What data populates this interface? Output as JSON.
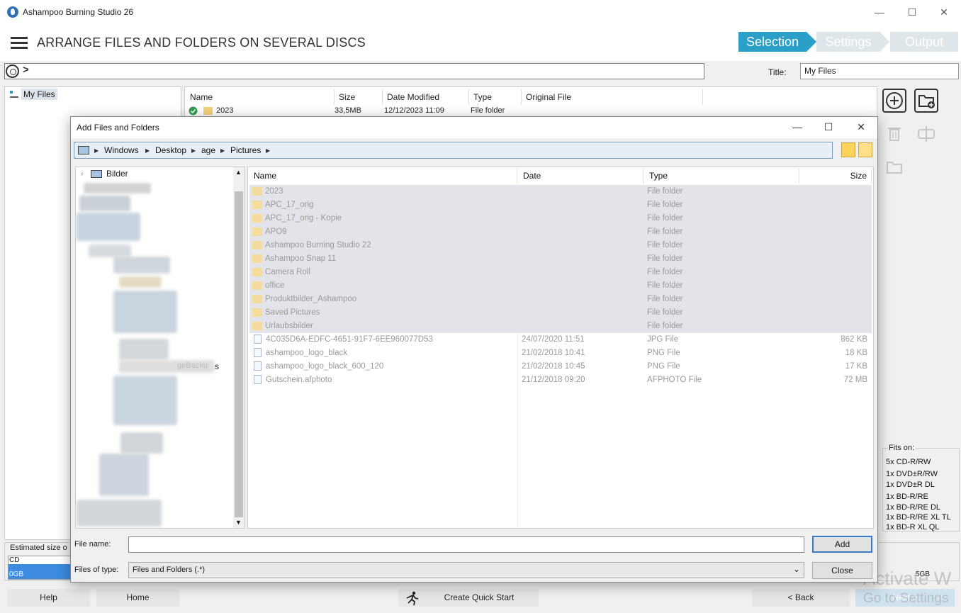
{
  "app": {
    "title": "Ashampoo Burning Studio 26"
  },
  "window_controls": {
    "minimize": "—",
    "maximize": "☐",
    "close": "✕"
  },
  "header": {
    "title": "ARRANGE FILES AND FOLDERS ON SEVERAL DISCS",
    "steps": [
      "Selection",
      "Settings",
      "Output"
    ],
    "active_step": "Selection",
    "accent_color": "#2a9fc8"
  },
  "pathbar": {
    "chevron": ">",
    "title_label": "Title:",
    "title_value": "My Files"
  },
  "tree": {
    "root": "My Files"
  },
  "list": {
    "columns": [
      "Name",
      "Size",
      "Date Modified",
      "Type",
      "Original File"
    ],
    "rows": [
      {
        "name": "2023",
        "size": "33,5MB",
        "date": "12/12/2023 11:09",
        "type": "File folder",
        "original": ""
      }
    ]
  },
  "side_tools": [
    "add-icon",
    "new-folder-icon",
    "trash-icon",
    "split-icon",
    "folder-open-icon"
  ],
  "fits": {
    "title": "Fits on:",
    "groups": [
      [
        "5x CD-R/RW"
      ],
      [
        "1x DVD±R/RW",
        "1x DVD±R DL"
      ],
      [
        "1x BD-R/RE",
        "1x BD-R/RE DL",
        "1x BD-R/RE XL TL",
        "1x BD-R XL QL"
      ]
    ]
  },
  "estimate": {
    "label": "Estimated size o",
    "cd_label": "CD",
    "zero_label": "0GB",
    "max_label": "5GB"
  },
  "bottom": {
    "help": "Help",
    "home": "Home",
    "quick_start": "Create Quick Start",
    "back": "< Back",
    "next": "Next >"
  },
  "watermark": {
    "line1": "Activate W",
    "line2": "Go to Settings"
  },
  "dialog": {
    "title": "Add Files and Folders",
    "crumbs": [
      "Windows",
      "Desktop",
      "age",
      "Pictures"
    ],
    "nav_root": "Bilder",
    "nav_partial": "s",
    "nav_blurred": "geBacku",
    "columns": [
      "Name",
      "Date",
      "Type",
      "Size"
    ],
    "folders": [
      {
        "name": "2023",
        "type": "File folder"
      },
      {
        "name": "APC_17_orig",
        "type": "File folder"
      },
      {
        "name": "APC_17_orig - Kopie",
        "type": "File folder"
      },
      {
        "name": "APO9",
        "type": "File folder"
      },
      {
        "name": "Ashampoo Burning Studio 22",
        "type": "File folder"
      },
      {
        "name": "Ashampoo Snap 11",
        "type": "File folder"
      },
      {
        "name": "Camera Roll",
        "type": "File folder"
      },
      {
        "name": "office",
        "type": "File folder"
      },
      {
        "name": "Produktbilder_Ashampoo",
        "type": "File folder"
      },
      {
        "name": "Saved Pictures",
        "type": "File folder"
      },
      {
        "name": "Urlaubsbilder",
        "type": "File folder"
      }
    ],
    "files": [
      {
        "name": "4C035D6A-EDFC-4651-91F7-6EE960077D53",
        "date": "24/07/2020 11:51",
        "type": "JPG File",
        "size": "862 KB"
      },
      {
        "name": "ashampoo_logo_black",
        "date": "21/02/2018 10:41",
        "type": "PNG File",
        "size": "18 KB"
      },
      {
        "name": "ashampoo_logo_black_600_120",
        "date": "21/02/2018 10:45",
        "type": "PNG File",
        "size": "17 KB"
      },
      {
        "name": "Gutschein.afphoto",
        "date": "21/12/2018 09:20",
        "type": "AFPHOTO File",
        "size": "72 MB"
      }
    ],
    "file_name_label": "File name:",
    "file_name_value": "",
    "file_type_label": "Files of type:",
    "file_type_value": "Files and Folders (.*)",
    "add_button": "Add",
    "close_button": "Close",
    "controls": {
      "minimize": "—",
      "maximize": "☐",
      "close": "✕"
    }
  }
}
